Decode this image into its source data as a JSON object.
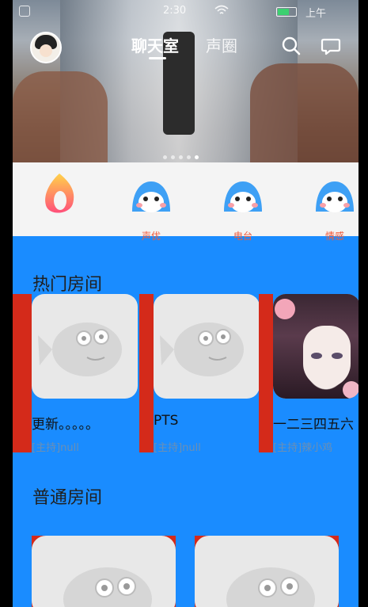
{
  "status_bar": {
    "time_fragment": "2:30",
    "clock": "上午"
  },
  "header": {
    "tabs": [
      {
        "label": "聊天室",
        "active": true
      },
      {
        "label": "声圈",
        "active": false
      }
    ],
    "search_icon": "search-icon",
    "chat_icon": "chat-bubble-icon",
    "avatar_icon": "avatar"
  },
  "banner": {
    "page_indicator_count": 5,
    "active_index": 4
  },
  "categories": [
    {
      "label": "",
      "icon": "flame-logo-icon"
    },
    {
      "label": "声优",
      "icon": "bird-mascot-icon"
    },
    {
      "label": "电台",
      "icon": "bird-mascot-icon"
    },
    {
      "label": "情感",
      "icon": "bird-mascot-icon"
    }
  ],
  "hot_rooms": {
    "title": "热门房间",
    "rooms": [
      {
        "name": "更新。。。。。",
        "host": "[主持]null",
        "image": "placeholder-fish"
      },
      {
        "name": "PTS",
        "host": "[主持]null",
        "image": "placeholder-fish"
      },
      {
        "name": "一二三四五六",
        "host": "[主持]辣小鸡",
        "image": "anime-girl"
      }
    ]
  },
  "normal_rooms": {
    "title": "普通房间"
  },
  "colors": {
    "accent_blue": "#1a8cff",
    "card_red": "#d42a1a",
    "host_text": "#6c8fb3",
    "category_label": "#f25a3a"
  }
}
